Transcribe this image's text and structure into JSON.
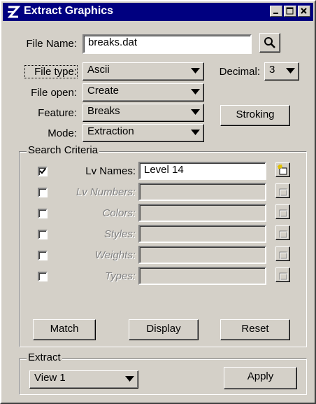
{
  "window": {
    "title": "Extract Graphics",
    "controls": [
      "minimize-icon",
      "maximize-icon",
      "close-icon"
    ]
  },
  "file": {
    "label": "File Name:",
    "value": "breaks.dat",
    "browse_icon": "magnifier-icon"
  },
  "options": {
    "file_type_label": "File type:",
    "file_type_value": "Ascii",
    "decimal_label": "Decimal:",
    "decimal_value": "3",
    "file_open_label": "File open:",
    "file_open_value": "Create",
    "feature_label": "Feature:",
    "feature_value": "Breaks",
    "stroking_button": "Stroking",
    "mode_label": "Mode:",
    "mode_value": "Extraction"
  },
  "search_criteria": {
    "title": "Search Criteria",
    "rows": [
      {
        "label": "Lv Names:",
        "value": "Level 14",
        "checked": true,
        "enabled": true
      },
      {
        "label": "Lv Numbers:",
        "value": "",
        "checked": false,
        "enabled": false
      },
      {
        "label": "Colors:",
        "value": "",
        "checked": false,
        "enabled": false
      },
      {
        "label": "Styles:",
        "value": "",
        "checked": false,
        "enabled": false
      },
      {
        "label": "Weights:",
        "value": "",
        "checked": false,
        "enabled": false
      },
      {
        "label": "Types:",
        "value": "",
        "checked": false,
        "enabled": false
      }
    ],
    "buttons": {
      "match": "Match",
      "display": "Display",
      "reset": "Reset"
    }
  },
  "extract": {
    "title": "Extract",
    "view_value": "View 1",
    "apply_button": "Apply"
  },
  "colors": {
    "titlebar": "#000080",
    "face": "#d4d0c8"
  }
}
